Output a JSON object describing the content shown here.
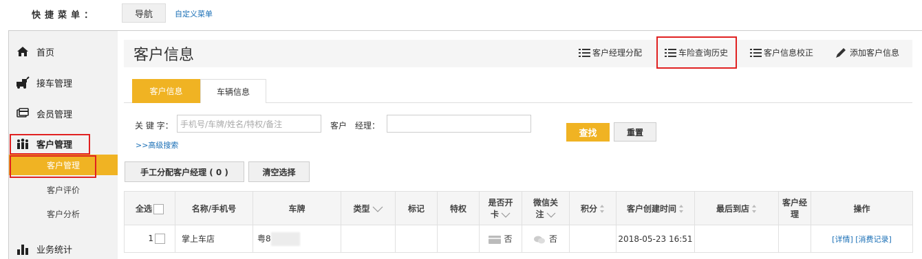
{
  "quick_menu": {
    "label": "快捷菜单：",
    "nav_button": "导航",
    "custom_link": "自定义菜单"
  },
  "sidebar": {
    "items": [
      {
        "label": "首页",
        "icon": "home-icon"
      },
      {
        "label": "接车管理",
        "icon": "car-icon"
      },
      {
        "label": "会员管理",
        "icon": "member-card-icon"
      },
      {
        "label": "客户管理",
        "icon": "people-icon"
      },
      {
        "label": "业务统计",
        "icon": "bar-chart-icon"
      }
    ],
    "sub_items": [
      "客户管理",
      "客户评价",
      "客户分析"
    ]
  },
  "page": {
    "title": "客户信息",
    "toolbar": {
      "assign_manager": "客户经理分配",
      "insurance_history": "车险查询历史",
      "info_correct": "客户信息校正",
      "add_customer": "添加客户信息"
    },
    "tabs": [
      "客户信息",
      "车辆信息"
    ]
  },
  "search": {
    "keyword_label": "关 键 字：",
    "keyword_placeholder": "手机号/车牌/姓名/特权/备注",
    "manager_label": "客户　经理：",
    "advanced_link": ">>高级搜索",
    "search_button": "查找",
    "reset_button": "重置"
  },
  "actions": {
    "manual_assign": "手工分配客户经理 ( 0 )",
    "clear_selection": "清空选择"
  },
  "table": {
    "headers": {
      "select_all": "全选",
      "name": "名称/手机号",
      "plate": "车牌",
      "type": "类型",
      "mark": "标记",
      "privilege": "特权",
      "card_line1": "是否开",
      "card_line2": "卡",
      "wechat_line1": "微信关",
      "wechat_line2": "注",
      "points": "积分",
      "created": "客户创建时间",
      "last_visit": "最后到店",
      "manager_line1": "客户经",
      "manager_line2": "理",
      "ops": "操作"
    },
    "rows": [
      {
        "index": "1",
        "name": "掌上车店",
        "plate": "粤8",
        "card": "否",
        "wechat": "否",
        "created": "2018-05-23 16:51",
        "detail_link": "[详情]",
        "consume_link": "[消费记录]"
      }
    ]
  },
  "colors": {
    "accent": "#f0b323",
    "link": "#1a6fb6",
    "highlight_border": "#e02020"
  }
}
